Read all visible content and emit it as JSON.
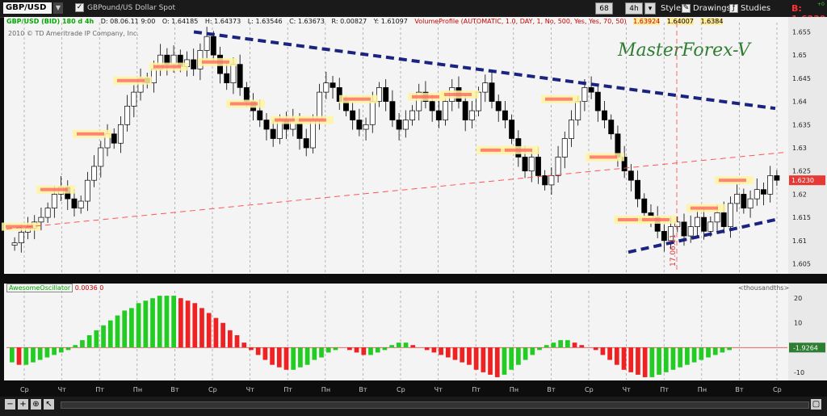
{
  "toolbar": {
    "symbol": "GBP/USD",
    "description": "GBPound/US Dollar Spot",
    "bar_count": "68",
    "timeframe": "4h",
    "style_label": "Style",
    "drawings_label": "Drawings",
    "studies_label": "Studies",
    "bid": "B: 1.6230",
    "right_tick": "+0"
  },
  "info": {
    "title": "GBP/USD (BID) 180 d 4h",
    "date": "D: 08.06.11 9:00",
    "open": "O: 1.64185",
    "high": "H: 1.64373",
    "low": "L: 1.63546",
    "close": "C: 1.63673",
    "range": "R: 0.00827",
    "y": "Y: 1.61097",
    "vp": "VolumeProfile (AUTOMATIC, 1.0, DAY, 1, No, 500, Yes, Yes, 70, 50)",
    "vp1": "1.63924",
    "vp2": "1.64007",
    "vp3": "1.6384",
    "copyright": "2010 © TD Ameritrade IP Company, Inc.",
    "watermark": "MasterForex-V",
    "vline_label": "17.06.11"
  },
  "osc": {
    "name": "AwesomeOscillator",
    "value": "0.0036",
    "value2": "0",
    "units": "<thousandths>",
    "current_label": "-1.9264"
  },
  "colors": {
    "up_bar": "#22cc22",
    "down_bar": "#ee2222",
    "trendline": "#1a237e",
    "channel": "#ff5555"
  },
  "chart_data": [
    {
      "type": "candlestick",
      "title": "GBP/USD (BID) 180 d 4h",
      "ylim": [
        1.603,
        1.657
      ],
      "y_ticks": [
        "1.655",
        "1.65",
        "1.645",
        "1.64",
        "1.635",
        "1.63",
        "1.625",
        "1.62",
        "1.615",
        "1.61",
        "1.605"
      ],
      "last_price_label": "1.6230",
      "x_labels": [
        "Ср",
        "Чт",
        "Пт",
        "Пн",
        "Вт",
        "Ср",
        "Чт",
        "Пт",
        "Пн",
        "Вт",
        "Ср",
        "Чт",
        "Пт",
        "Пн",
        "Вт",
        "Ср",
        "Чт",
        "Пт",
        "Пн",
        "Вт",
        "Ср"
      ],
      "close": [
        1.6095,
        1.6118,
        1.6127,
        1.614,
        1.615,
        1.617,
        1.62,
        1.6215,
        1.619,
        1.617,
        1.6185,
        1.623,
        1.626,
        1.63,
        1.633,
        1.631,
        1.635,
        1.639,
        1.642,
        1.645,
        1.644,
        1.647,
        1.65,
        1.648,
        1.65,
        1.6475,
        1.649,
        1.647,
        1.651,
        1.654,
        1.65,
        1.646,
        1.644,
        1.648,
        1.643,
        1.64,
        1.638,
        1.636,
        1.634,
        1.632,
        1.636,
        1.634,
        1.636,
        1.632,
        1.63,
        1.636,
        1.642,
        1.644,
        1.643,
        1.64,
        1.638,
        1.636,
        1.634,
        1.635,
        1.64,
        1.643,
        1.64,
        1.636,
        1.634,
        1.636,
        1.638,
        1.642,
        1.64,
        1.638,
        1.636,
        1.64,
        1.643,
        1.64,
        1.636,
        1.638,
        1.642,
        1.644,
        1.64,
        1.638,
        1.636,
        1.632,
        1.628,
        1.625,
        1.628,
        1.624,
        1.622,
        1.624,
        1.628,
        1.632,
        1.636,
        1.64,
        1.643,
        1.642,
        1.638,
        1.636,
        1.633,
        1.628,
        1.625,
        1.623,
        1.619,
        1.616,
        1.615,
        1.612,
        1.61,
        1.613,
        1.614,
        1.611,
        1.613,
        1.615,
        1.612,
        1.614,
        1.616,
        1.613,
        1.618,
        1.62,
        1.617,
        1.619,
        1.621,
        1.62,
        1.624,
        1.623
      ],
      "trendlines": [
        {
          "name": "upper",
          "points": [
            [
              1.655
            ],
            [
              1.6385
            ]
          ],
          "style": "dashed-bold"
        },
        {
          "name": "lower",
          "points": [
            [
              1.6075
            ],
            [
              1.6145
            ]
          ],
          "style": "dashed-bold"
        },
        {
          "name": "channel",
          "points": [
            [
              1.6125
            ],
            [
              1.629
            ]
          ],
          "style": "dashed-thin"
        }
      ]
    },
    {
      "type": "bar",
      "title": "AwesomeOscillator",
      "ylim": [
        -13,
        23
      ],
      "y_ticks": [
        "20",
        "10",
        "0",
        "-10"
      ],
      "values": [
        -6,
        -7,
        -7,
        -6,
        -5,
        -4,
        -3,
        -2,
        -1,
        1,
        3,
        5,
        7,
        9,
        11,
        13,
        15,
        16,
        18,
        19,
        20,
        21,
        21,
        21,
        20,
        19,
        18,
        16,
        14,
        12,
        10,
        7,
        5,
        2,
        -1,
        -3,
        -5,
        -7,
        -8,
        -9,
        -9,
        -8,
        -7,
        -5,
        -4,
        -2,
        -1,
        0,
        -1,
        -2,
        -3,
        -3,
        -2,
        -1,
        1,
        2,
        2,
        1,
        0,
        -1,
        -2,
        -3,
        -4,
        -5,
        -6,
        -7,
        -9,
        -10,
        -11,
        -12,
        -11,
        -9,
        -7,
        -5,
        -3,
        -1,
        1,
        2,
        3,
        3,
        2,
        1,
        0,
        -1,
        -3,
        -5,
        -7,
        -9,
        -10,
        -11,
        -12,
        -12,
        -11,
        -10,
        -9,
        -8,
        -7,
        -6,
        -5,
        -4,
        -3,
        -2,
        -1
      ]
    }
  ]
}
